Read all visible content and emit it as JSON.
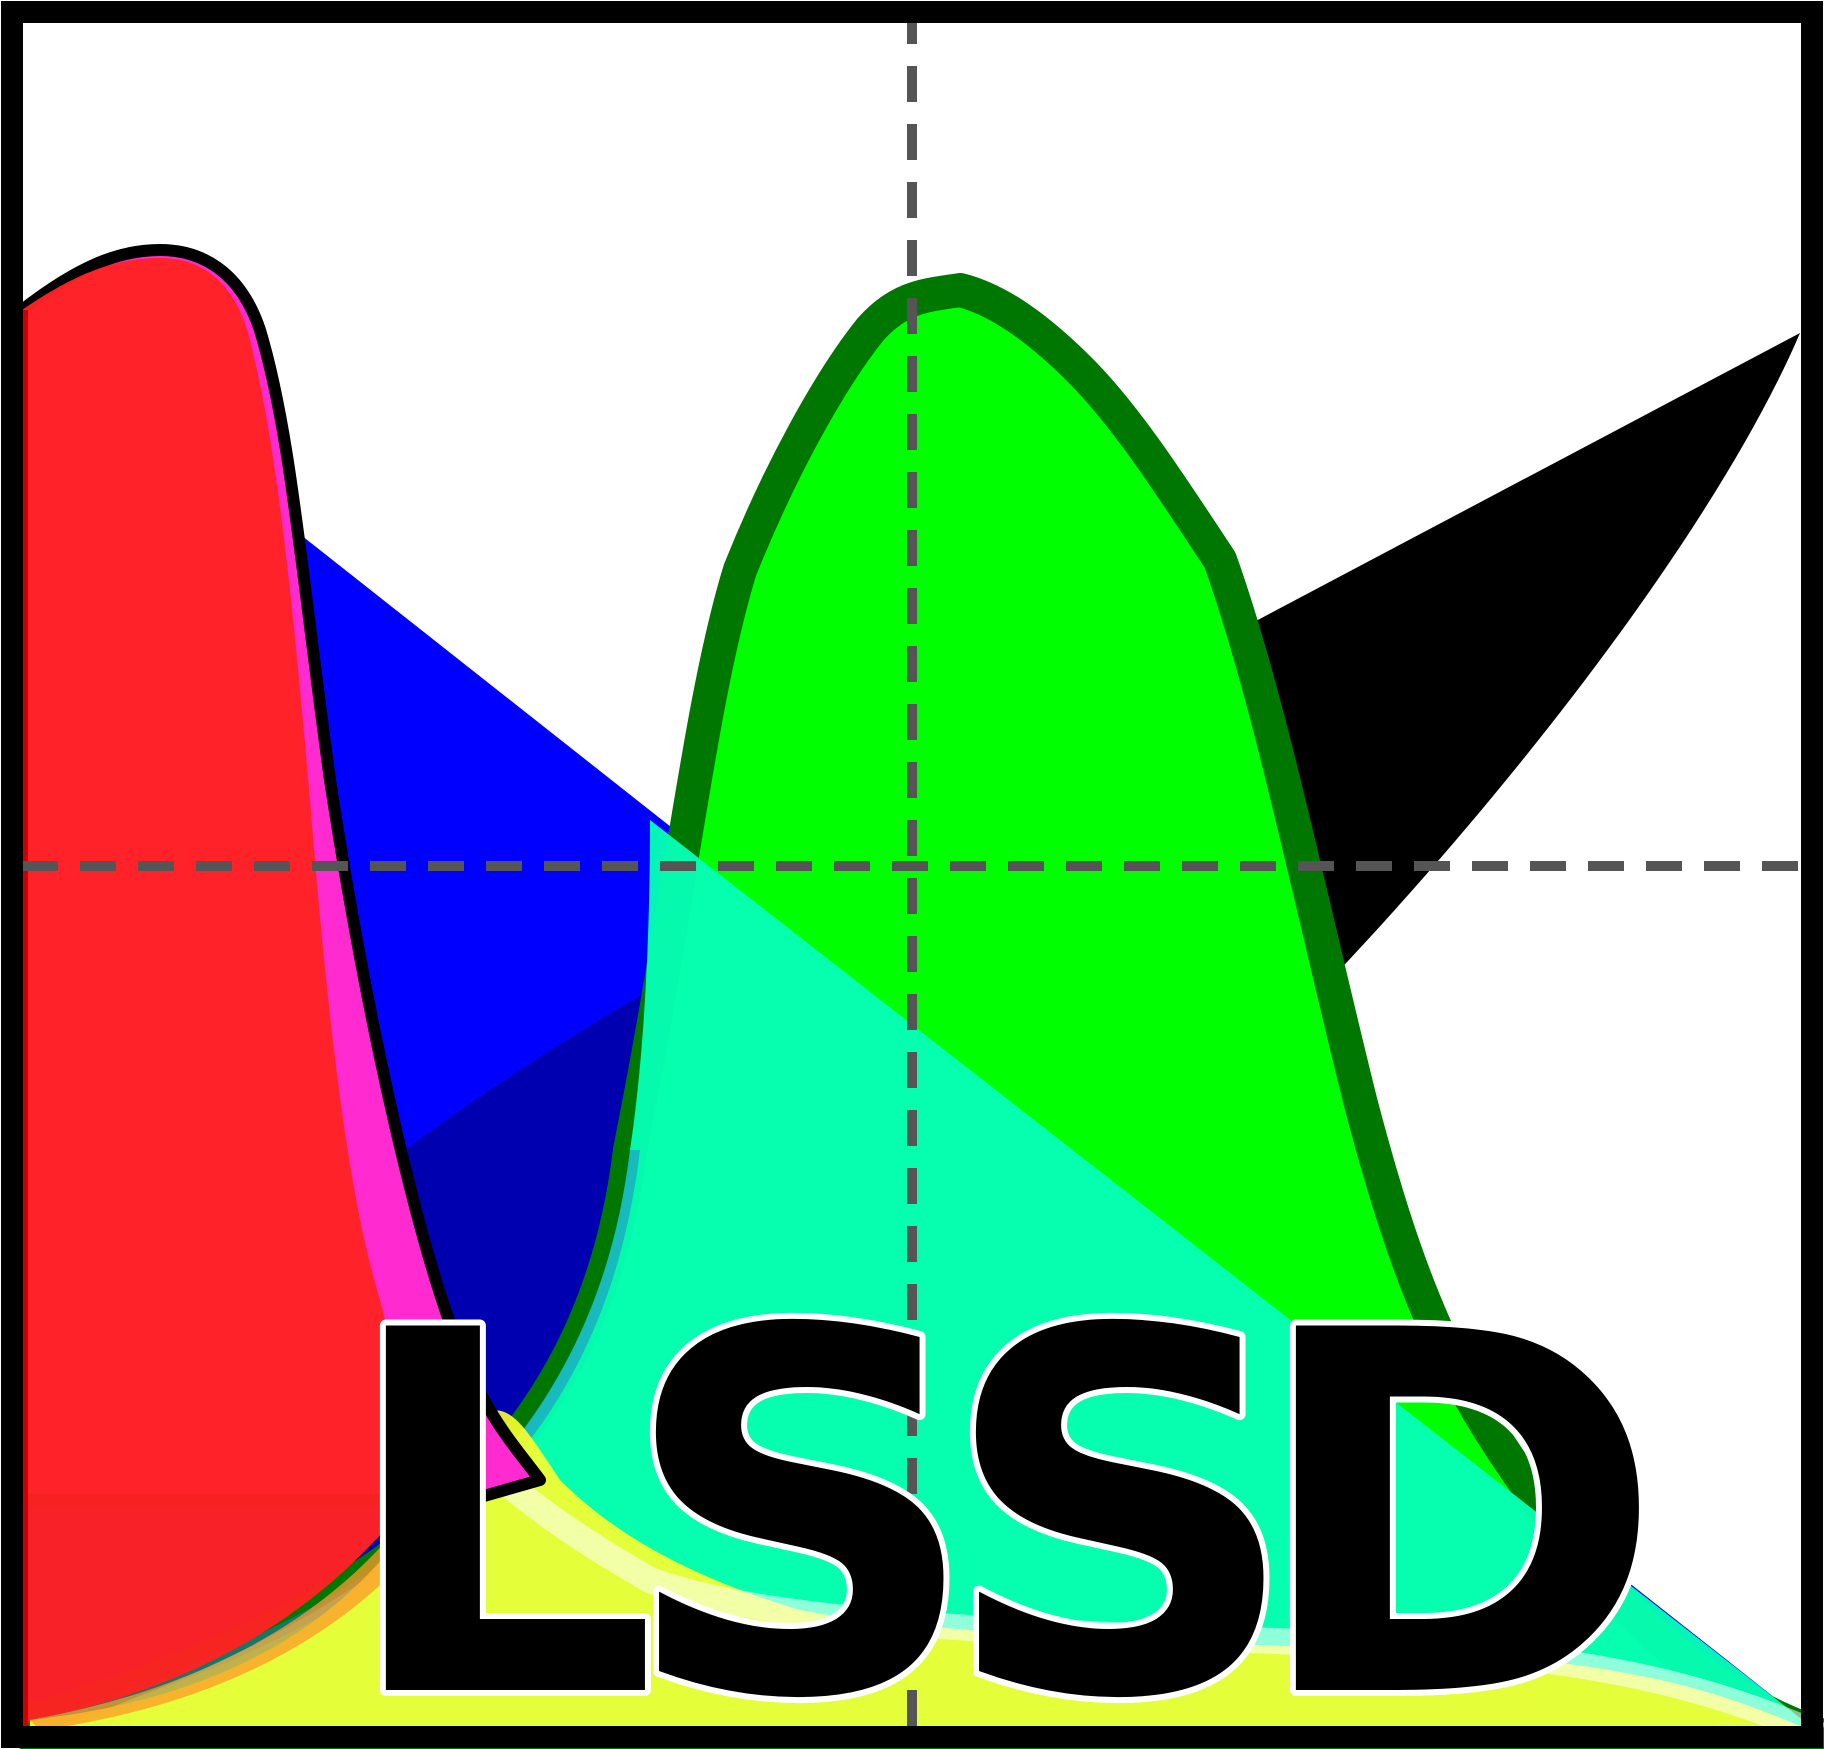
{
  "logo": {
    "letters": [
      "L",
      "S",
      "S",
      "D"
    ]
  },
  "colors": {
    "frame": "#000000",
    "red": "#ff2222",
    "magenta": "#ff2ad0",
    "blue": "#0000ff",
    "dark_blue": "#0000b0",
    "green": "#00ff00",
    "dark_green": "#007700",
    "cyan": "#05ffb5",
    "yellow": "#fdff2e",
    "grid": "#555555"
  }
}
